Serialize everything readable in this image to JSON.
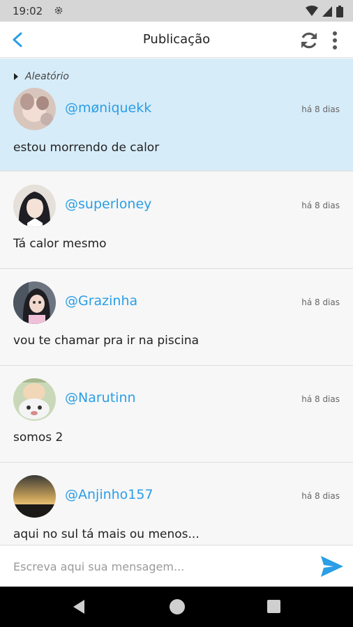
{
  "status_bar": {
    "time": "19:02"
  },
  "app_bar": {
    "title": "Publicação"
  },
  "posts": [
    {
      "category": "Aleatório",
      "username": "@møniquekk",
      "time_ago": "há 8 dias",
      "message": "estou morrendo de calor"
    },
    {
      "username": "@superloney",
      "time_ago": "há 8 dias",
      "message": "Tá calor mesmo"
    },
    {
      "username": "@Grazinha",
      "time_ago": "há 8 dias",
      "message": "vou te chamar pra ir na piscina"
    },
    {
      "username": "@Narutinn",
      "time_ago": "há 8 dias",
      "message": "somos 2"
    },
    {
      "username": "@Anjinho157",
      "time_ago": "há 8 dias",
      "message": "aqui no sul tá mais ou menos..."
    }
  ],
  "composer": {
    "placeholder": "Escreva aqui sua mensagem..."
  },
  "colors": {
    "accent": "#2a9ee6",
    "highlight_bg": "#d7ecf9"
  }
}
